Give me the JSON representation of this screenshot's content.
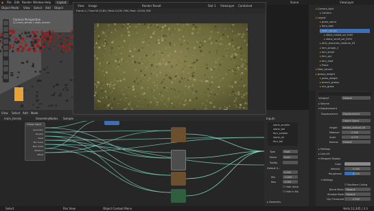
{
  "topbar": {
    "file_menu": [
      "File",
      "Edit",
      "Render",
      "Window",
      "Help"
    ],
    "workspace_tabs": [
      "Layout"
    ],
    "scene_label": "Scene",
    "viewlayer_label": "ViewLayer"
  },
  "viewport": {
    "mode": "Object Mode",
    "menus": [
      "View",
      "Select",
      "Add",
      "Object"
    ],
    "camera_label": "Camera Perspective",
    "collection_label": "(1) main_terrain | main_terrain"
  },
  "render_window": {
    "menus": [
      "View",
      "Image"
    ],
    "image_name": "Render Result",
    "slot_label": "Slot 1",
    "layer_label": "ViewLayer",
    "pass_label": "Combined",
    "info_text": "Frame:1 | Time:00:13.83 | Mem:12235.79M, Peak: 12326.70M"
  },
  "node_editor": {
    "menus": [
      "View",
      "Select",
      "Add",
      "Node"
    ],
    "object_name": "main_terrain",
    "editor_type": "GeometryNodes",
    "tree_label": "Sample",
    "group_input_label": "Group Input",
    "group_input_sockets": [
      "Geometry",
      "Density",
      "Seed",
      "Min Scale",
      "Max Scale",
      "Rotation",
      "Offset",
      "Randomness"
    ]
  },
  "node_props": {
    "header": "Inputs",
    "socket_list": [
      "stone_smaller",
      "stone_tall",
      "fern_smaller",
      "stone_dir",
      "fern_tall"
    ],
    "type_label": "Type",
    "type_value": "Float",
    "name_label": "Name",
    "name_value": "Scale",
    "tooltip_label": "Tooltip",
    "default_label": "Default S...",
    "default_value": "0.000",
    "min_label": "Min",
    "min_value": "-3.000",
    "max_label": "Max",
    "max_value": "3.000",
    "min2_label": "Min",
    "min2_value": "-10000.000",
    "max2_label": "Max",
    "max2_value": "10000.000",
    "hide_value_label": "Hide Value",
    "hide_in_mod_label": "Hide in Mo",
    "geometry_label": "Geometry"
  },
  "outliner": {
    "items": [
      {
        "name": "Camera_light",
        "indent": 1
      },
      {
        "name": "Camera",
        "indent": 2
      },
      {
        "name": "Layout",
        "indent": 1
      },
      {
        "name": "grass_stand",
        "indent": 2
      },
      {
        "name": "flora_lake",
        "indent": 2
      },
      {
        "name": "main_terrain",
        "indent": 2
      },
      {
        "name": "stone_mixed_sel_5x50",
        "indent": 3
      },
      {
        "name": "stone_small_sel_5x50",
        "indent": 3
      },
      {
        "name": "dirty_branches_medium_03",
        "indent": 2
      },
      {
        "name": "fern_simple_1",
        "indent": 2
      },
      {
        "name": "fern_small",
        "indent": 2
      },
      {
        "name": "fern_pyr",
        "indent": 2
      },
      {
        "name": "fern_mod",
        "indent": 2
      },
      {
        "name": "Plane",
        "indent": 2
      },
      {
        "name": "Main_terrain",
        "indent": 1
      },
      {
        "name": "grassy_weight",
        "indent": 1
      },
      {
        "name": "grass_weight",
        "indent": 2
      },
      {
        "name": "branch_grassy",
        "indent": 2
      },
      {
        "name": "rice_grass",
        "indent": 2
      }
    ]
  },
  "properties": {
    "search_placeholder": "",
    "viewport_label": "Viewport",
    "viewport_value": "Default",
    "volume_label": "Volume",
    "displacement_label": "Displacement",
    "displacement_method_label": "Displacement",
    "displacement_method_value": "Displacement",
    "object_space_value": "Object Space",
    "height_label": "Height",
    "height_value": "terrain_texture_04",
    "midlevel_label": "Midlevel",
    "midlevel_value": "0.500",
    "scale_label": "Scale",
    "scale_value": "0.070",
    "normal_label": "Normal",
    "normal_value": "Default",
    "settings_label": "Settings",
    "lineart_label": "Line Art",
    "custom_props_label": "Custom Properties",
    "viewport_display_label": "Viewport Display",
    "color_label": "Color",
    "metallic_label": "Metallic",
    "metallic_value": "0.000",
    "roughness_label": "Roughness",
    "roughness_value": "0.400",
    "settings2_label": "Settings",
    "backface_label": "Backface Culling",
    "blend_mode_label": "Blend Mode",
    "blend_mode_value": "Opaque",
    "shadow_mode_label": "Shadow Mode",
    "shadow_mode_value": "Opaque",
    "clip_label": "Clip Threshold",
    "clip_value": "0.500"
  },
  "status": {
    "select": "Select",
    "pan": "Pan View",
    "context": "Object Context Menu",
    "stats": "Verts:12,345 | 3.3"
  },
  "colors": {
    "accent": "#3d70b2",
    "node_green": "#2f5f3f",
    "node_brown": "#6b5030",
    "node_grey": "#4d4d4d",
    "link_teal": "#7fd8c0",
    "orange_card": "#e8a23a"
  }
}
